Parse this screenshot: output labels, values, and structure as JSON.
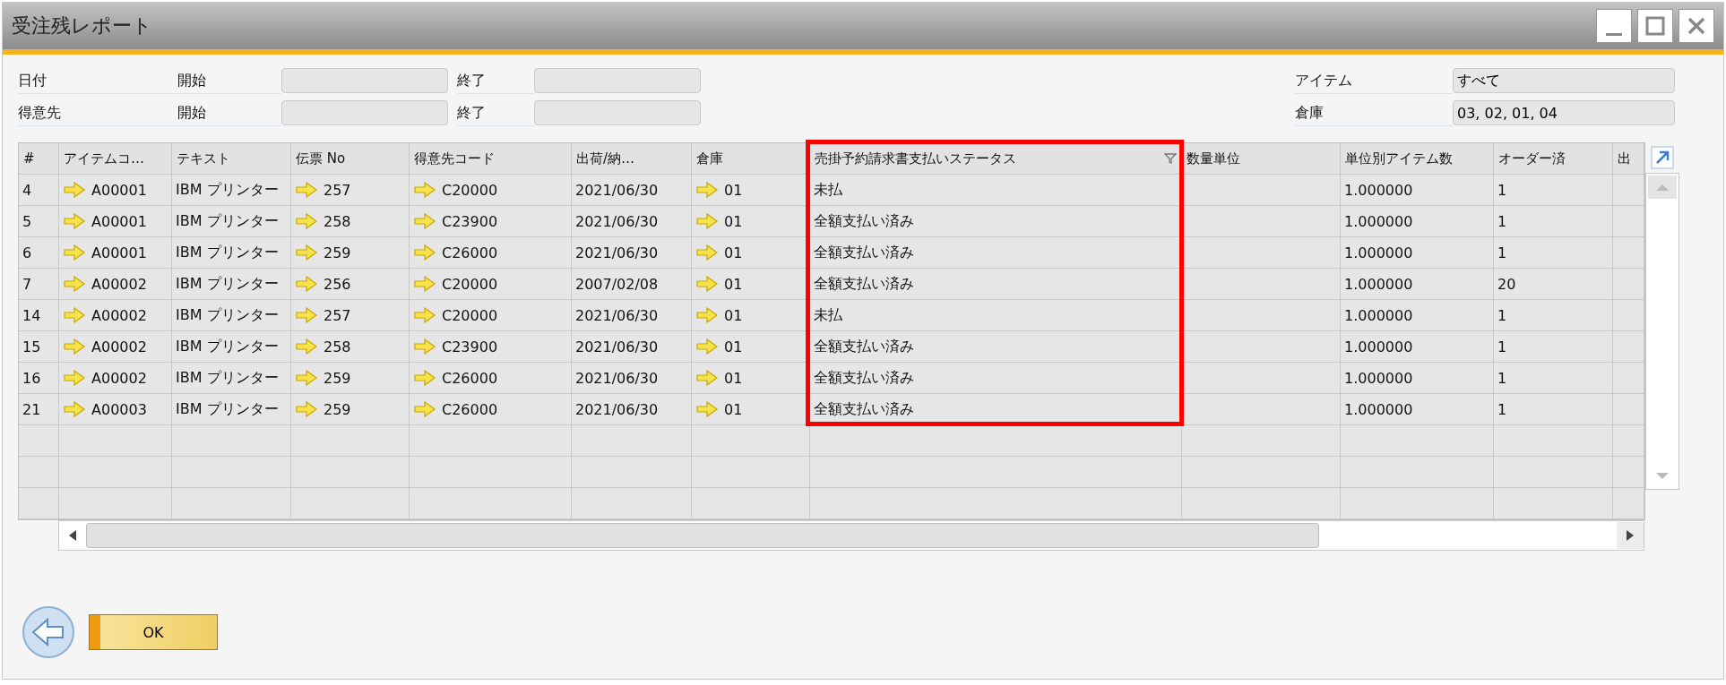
{
  "window": {
    "title": "受注残レポート"
  },
  "filters_left": [
    {
      "label": "日付",
      "from_label": "開始",
      "to_label": "終了"
    },
    {
      "label": "得意先",
      "from_label": "開始",
      "to_label": "終了"
    }
  ],
  "filters_right": [
    {
      "label": "アイテム",
      "value": "すべて"
    },
    {
      "label": "倉庫",
      "value": "03, 02, 01, 04"
    }
  ],
  "table": {
    "columns": [
      {
        "label": "#",
        "kind": "text",
        "filtered": false,
        "highlighted": false
      },
      {
        "label": "アイテムコ…",
        "kind": "link",
        "filtered": false,
        "highlighted": false
      },
      {
        "label": "テキスト",
        "kind": "text",
        "filtered": false,
        "highlighted": false
      },
      {
        "label": "伝票 No",
        "kind": "link",
        "filtered": false,
        "highlighted": false
      },
      {
        "label": "得意先コード",
        "kind": "link",
        "filtered": false,
        "highlighted": false
      },
      {
        "label": "出荷/納…",
        "kind": "text",
        "filtered": false,
        "highlighted": false
      },
      {
        "label": "倉庫",
        "kind": "link",
        "filtered": false,
        "highlighted": false
      },
      {
        "label": "売掛予約請求書支払いステータス",
        "kind": "text",
        "filtered": true,
        "highlighted": true
      },
      {
        "label": "数量単位",
        "kind": "text",
        "filtered": false,
        "highlighted": false
      },
      {
        "label": "単位別アイテム数",
        "kind": "text",
        "filtered": false,
        "highlighted": false
      },
      {
        "label": "オーダー済",
        "kind": "text",
        "filtered": false,
        "highlighted": false
      },
      {
        "label": "出",
        "kind": "text",
        "filtered": false,
        "highlighted": false
      }
    ],
    "rows": [
      [
        "4",
        "A00001",
        "IBM プリンター",
        "257",
        "C20000",
        "2021/06/30",
        "01",
        "未払",
        "",
        "1.000000",
        "1",
        ""
      ],
      [
        "5",
        "A00001",
        "IBM プリンター",
        "258",
        "C23900",
        "2021/06/30",
        "01",
        "全額支払い済み",
        "",
        "1.000000",
        "1",
        ""
      ],
      [
        "6",
        "A00001",
        "IBM プリンター",
        "259",
        "C26000",
        "2021/06/30",
        "01",
        "全額支払い済み",
        "",
        "1.000000",
        "1",
        ""
      ],
      [
        "7",
        "A00002",
        "IBM プリンター",
        "256",
        "C20000",
        "2007/02/08",
        "01",
        "全額支払い済み",
        "",
        "1.000000",
        "20",
        ""
      ],
      [
        "14",
        "A00002",
        "IBM プリンター",
        "257",
        "C20000",
        "2021/06/30",
        "01",
        "未払",
        "",
        "1.000000",
        "1",
        ""
      ],
      [
        "15",
        "A00002",
        "IBM プリンター",
        "258",
        "C23900",
        "2021/06/30",
        "01",
        "全額支払い済み",
        "",
        "1.000000",
        "1",
        ""
      ],
      [
        "16",
        "A00002",
        "IBM プリンター",
        "259",
        "C26000",
        "2021/06/30",
        "01",
        "全額支払い済み",
        "",
        "1.000000",
        "1",
        ""
      ],
      [
        "21",
        "A00003",
        "IBM プリンター",
        "259",
        "C26000",
        "2021/06/30",
        "01",
        "全額支払い済み",
        "",
        "1.000000",
        "1",
        ""
      ]
    ]
  },
  "buttons": [
    "OK"
  ]
}
